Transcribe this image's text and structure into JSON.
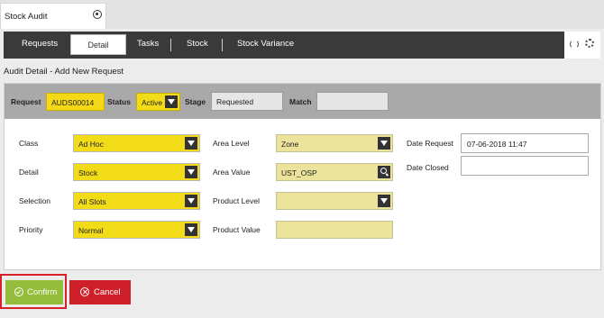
{
  "window": {
    "tab_title": "Stock Audit"
  },
  "nav": {
    "items": [
      "Requests",
      "Detail",
      "Tasks",
      "Stock",
      "Stock Variance"
    ]
  },
  "subtitle": "Audit Detail - Add New Request",
  "request_bar": {
    "request_label": "Request",
    "request_value": "AUDS00014",
    "status_label": "Status",
    "status_value": "Active",
    "stage_label": "Stage",
    "stage_value": "Requested",
    "match_label": "Match",
    "match_value": ""
  },
  "form": {
    "class_label": "Class",
    "class_value": "Ad Hoc",
    "detail_label": "Detail",
    "detail_value": "Stock",
    "selection_label": "Selection",
    "selection_value": "All Slots",
    "priority_label": "Priority",
    "priority_value": "Normal",
    "area_level_label": "Area Level",
    "area_level_value": "Zone",
    "area_value_label": "Area Value",
    "area_value_value": "UST_OSP",
    "product_level_label": "Product Level",
    "product_level_value": "",
    "product_value_label": "Product Value",
    "product_value_value": "",
    "date_request_label": "Date Request",
    "date_request_value": "07-06-2018 11:47",
    "date_closed_label": "Date Closed",
    "date_closed_value": ""
  },
  "buttons": {
    "confirm": "Confirm",
    "cancel": "Cancel"
  },
  "colors": {
    "accent_yellow": "#f2db17",
    "confirm_green": "#93bd3b",
    "cancel_red": "#cf1f2a",
    "nav_dark": "#3a3a3a"
  }
}
